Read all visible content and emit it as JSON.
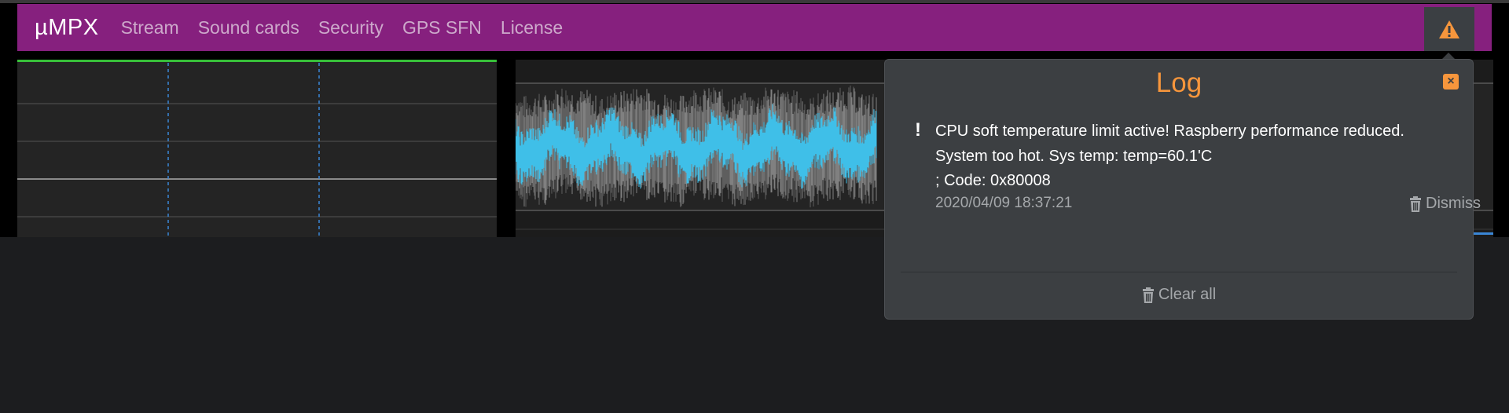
{
  "navbar": {
    "brand": "µMPX",
    "links": [
      "Stream",
      "Sound cards",
      "Security",
      "GPS SFN",
      "License"
    ],
    "alert_icon": "warning-triangle-icon",
    "background": "#86207e",
    "alert_color": "#f7963c"
  },
  "log": {
    "title": "Log",
    "close_icon": "close-icon",
    "entries": [
      {
        "icon": "exclamation-icon",
        "message": "CPU soft temperature limit active! Raspberry performance reduced.\nSystem too hot. Sys temp: temp=60.1'C\n; Code: 0x80008",
        "timestamp": "2020/04/09 18:37:21",
        "dismiss_label": "Dismiss"
      }
    ],
    "clear_all_label": "Clear all"
  },
  "colors": {
    "waveform_primary": "#3fbfe8",
    "waveform_secondary": "#808080",
    "meter_green": "#38c03a",
    "grid_blue": "#3a86d6"
  }
}
